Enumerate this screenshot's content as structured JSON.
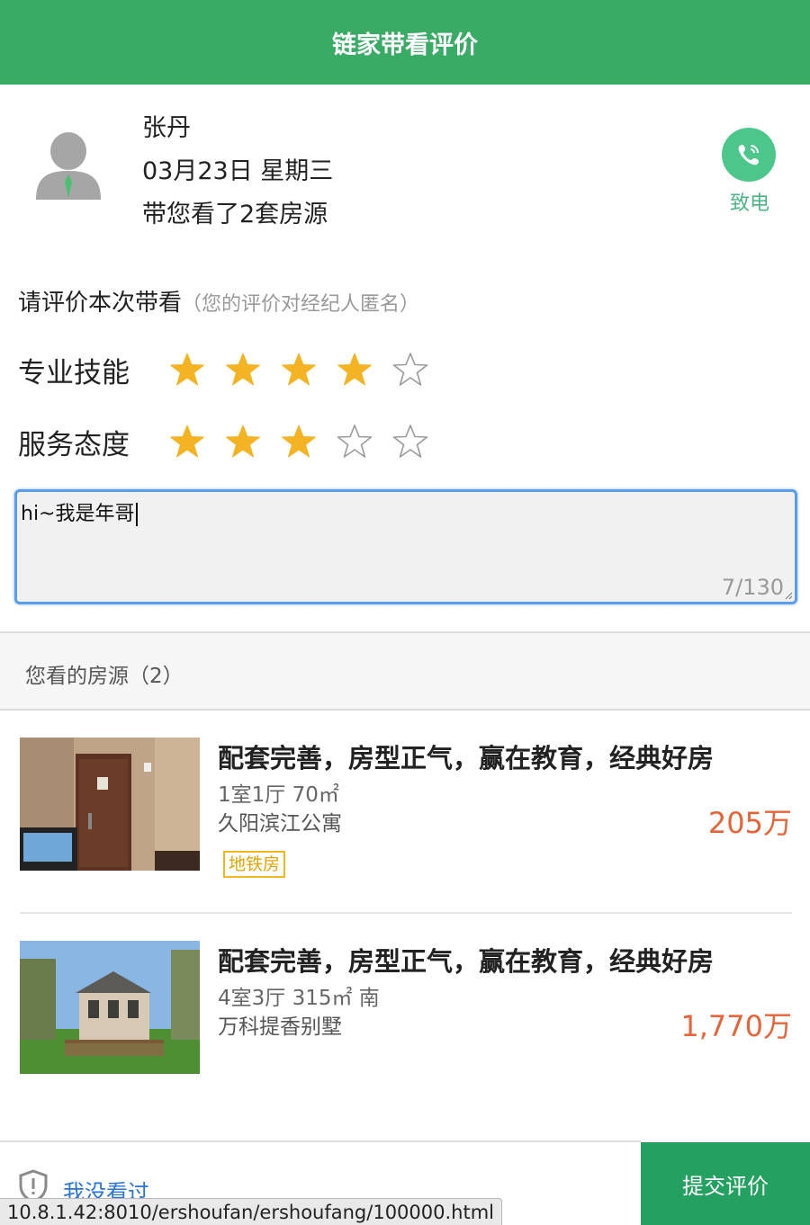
{
  "header": {
    "title": "链家带看评价"
  },
  "agent": {
    "name": "张丹",
    "date": "03月23日 星期三",
    "summary": "带您看了2套房源",
    "call_label": "致电",
    "avatar_icon": "person-avatar-icon",
    "call_icon": "phone-icon"
  },
  "review": {
    "prompt": "请评价本次带看",
    "prompt_hint": "（您的评价对经纪人匿名）",
    "ratings": [
      {
        "label": "专业技能",
        "value": 4,
        "max": 5
      },
      {
        "label": "服务态度",
        "value": 3,
        "max": 5
      }
    ],
    "comment_value": "hi~我是年哥",
    "counter": "7/130"
  },
  "listings_section": {
    "title": "您看的房源（2）"
  },
  "listings": [
    {
      "title": "配套完善，房型正气，赢在教育，经典好房",
      "spec": "1室1厅 70㎡",
      "community": "久阳滨江公寓",
      "price": "205万",
      "tag": "地铁房"
    },
    {
      "title": "配套完善，房型正气，赢在教育，经典好房",
      "spec": "4室3厅 315㎡ 南",
      "community": "万科提香别墅",
      "price": "1,770万"
    }
  ],
  "footer": {
    "not_seen_label": "我没看过",
    "submit_label": "提交评价",
    "status_url": "10.8.1.42:8010/ershoufan/ershoufang/100000.html",
    "shield_icon": "shield-icon"
  },
  "colors": {
    "brand_green": "#3aab64",
    "submit_green": "#24a160",
    "star_gold": "#f4b322",
    "price_orange": "#e5643a",
    "link_blue": "#2a74d6"
  }
}
